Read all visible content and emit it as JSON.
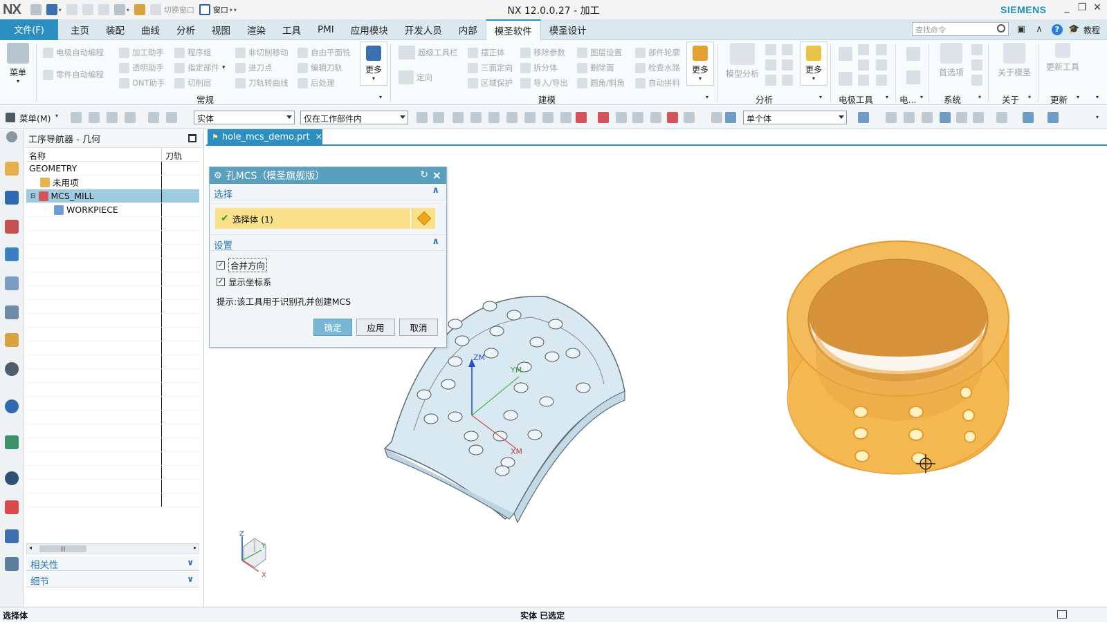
{
  "titlebar": {
    "logo": "NX",
    "title": "NX 12.0.0.27 - 加工",
    "brand": "SIEMENS",
    "switch_window": "切换窗口",
    "window_menu": "窗口",
    "minimize": "_",
    "restore": "❐",
    "close": "✕"
  },
  "menubar": {
    "file": "文件(F)",
    "tabs": [
      "主页",
      "装配",
      "曲线",
      "分析",
      "视图",
      "渲染",
      "工具",
      "PMI",
      "应用模块",
      "开发人员",
      "内部",
      "模圣软件",
      "模圣设计"
    ],
    "active_tab": "模圣软件",
    "search_placeholder": "查找命令",
    "tutorial": "教程"
  },
  "ribbon": {
    "menu_label": "菜单",
    "group1": {
      "items": [
        "电极自动编程",
        "加工助手",
        "程序组",
        "非切削移动",
        "自由平面铣",
        "零件自动编程",
        "透明助手",
        "指定部件",
        "进刀点",
        "编辑刀轨",
        "ONT助手",
        "切削层",
        "刀轨转曲线",
        "后处理"
      ],
      "more": "更多",
      "label": "常规"
    },
    "group2": {
      "items": [
        "超级工具栏",
        "摆正体",
        "移除参数",
        "图层设置",
        "部件轮廓",
        "定向",
        "三面定向",
        "拆分体",
        "删除面",
        "检查水路",
        "区域保护",
        "导入/导出",
        "圆角/斜角",
        "自动拼料"
      ],
      "more": "更多",
      "label": "建模"
    },
    "group3": {
      "big": "模型分析",
      "more": "更多",
      "label": "分析"
    },
    "group4": {
      "label": "电极工具"
    },
    "group5": {
      "label": "电..."
    },
    "group6": {
      "big": "首选项",
      "label": "系统"
    },
    "group7": {
      "big": "关于模圣",
      "label": "关于"
    },
    "group8": {
      "big": "更新工具",
      "label": "更新"
    }
  },
  "toolbar2": {
    "menu": "菜单(M)",
    "filter_type": "实体",
    "filter_scope": "仅在工作部件内",
    "body_rule": "单个体"
  },
  "navigator": {
    "title": "工序导航器 - 几何",
    "col_name": "名称",
    "col_toolpath": "刀轨",
    "rows": [
      {
        "name": "GEOMETRY"
      },
      {
        "name": "未用项"
      },
      {
        "name": "MCS_MILL"
      },
      {
        "name": "WORKPIECE"
      }
    ],
    "scroll_thumb": "|||",
    "sections": [
      "相关性",
      "细节"
    ]
  },
  "document_tab": {
    "name": "hole_mcs_demo.prt",
    "close": "✕"
  },
  "dialog": {
    "title": "孔MCS（模圣旗舰版）",
    "section_select": "选择",
    "select_body": "选择体 (1)",
    "section_settings": "设置",
    "merge_direction": "合并方向",
    "show_csys": "显示坐标系",
    "hint": "提示:该工具用于识别孔并创建MCS",
    "ok": "确定",
    "apply": "应用",
    "cancel": "取消"
  },
  "viewport": {
    "axis_z": "ZM",
    "axis_y": "YM",
    "axis_x": "XM",
    "triad_z": "Z",
    "triad_y": "Y",
    "triad_x": "X"
  },
  "statusbar": {
    "left": "选择体",
    "center": "实体 已选定"
  },
  "colors": {
    "accent": "#2c8fbf",
    "selection_highlight": "#fbe08a",
    "part_orange": "#f2b24a",
    "part_blue": "#d7e8f2"
  }
}
